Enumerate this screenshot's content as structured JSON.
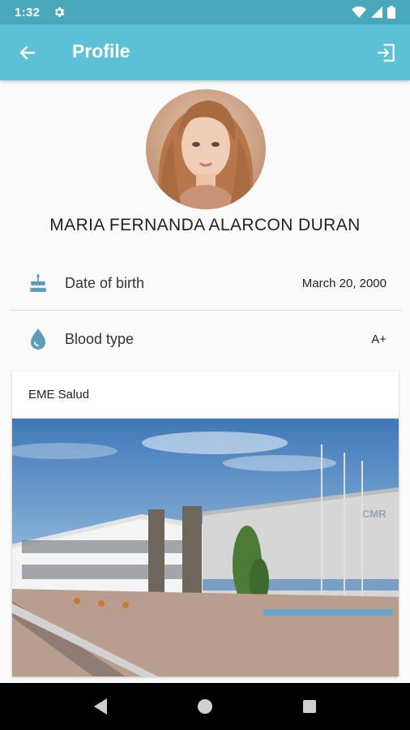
{
  "status_bar": {
    "time": "1:32"
  },
  "app_bar": {
    "title": "Profile"
  },
  "profile": {
    "name": "MARIA FERNANDA ALARCON DURAN"
  },
  "info": [
    {
      "label": "Date of birth",
      "value": "March 20, 2000",
      "icon": "cake-icon"
    },
    {
      "label": "Blood type",
      "value": "A+",
      "icon": "blood-drop-icon"
    }
  ],
  "card": {
    "title": "EME Salud",
    "sign_text": "CMR"
  },
  "colors": {
    "status_bar": "#4aa8bd",
    "app_bar": "#5cc0d6",
    "icon_accent": "#5b9cbf"
  }
}
